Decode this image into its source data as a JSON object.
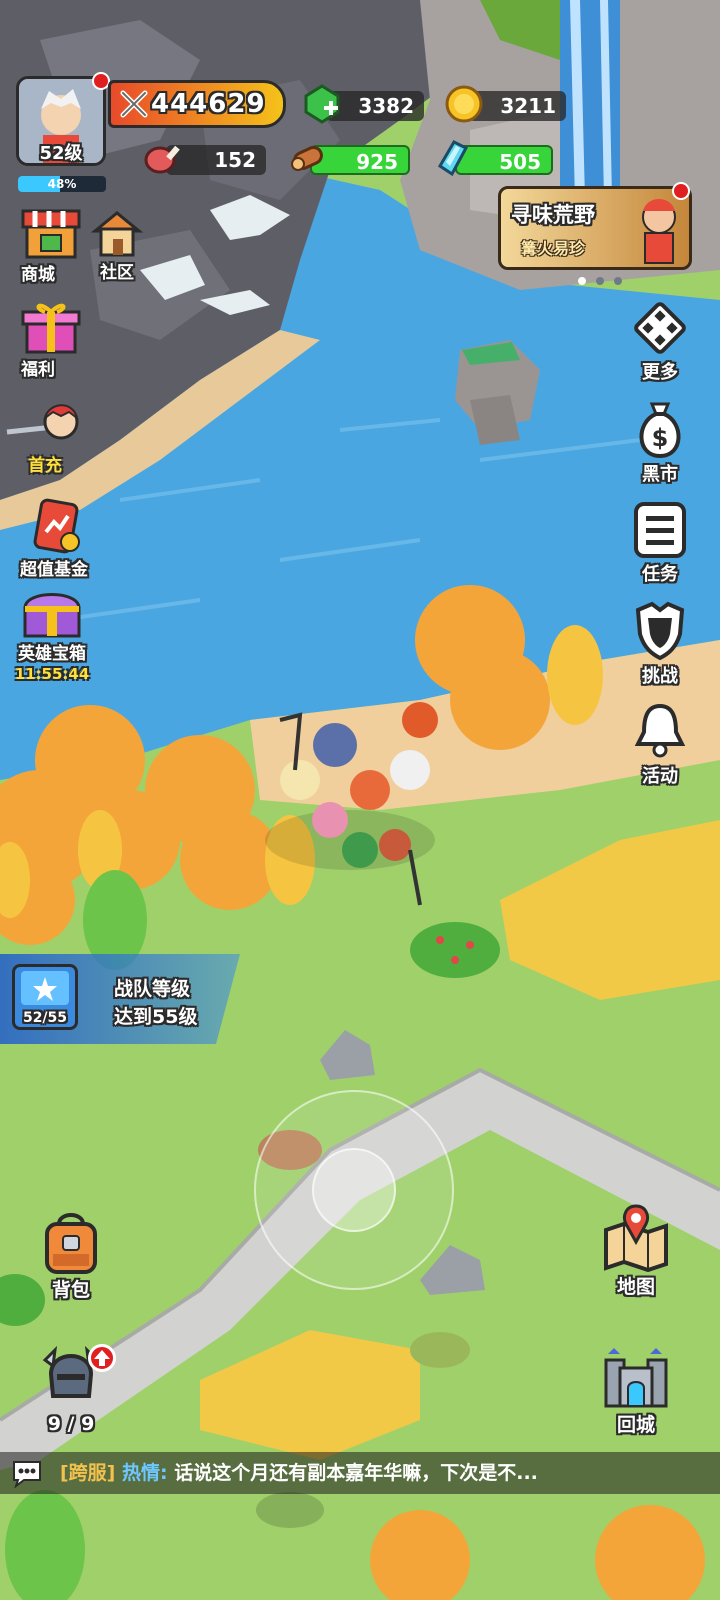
{
  "player": {
    "level_label": "52级",
    "exp_percent_label": "48%",
    "exp_fraction": 0.48,
    "power": "444629"
  },
  "resources": {
    "gems": "3382",
    "gold": "3211",
    "meat": "152",
    "wood": "925",
    "crystal": "505"
  },
  "left_menu": {
    "shop": "商城",
    "community": "社区",
    "welfare": "福利",
    "first_recharge": "首充",
    "fund": "超值基金",
    "hero_chest": "英雄宝箱",
    "hero_chest_timer": "11:55:44"
  },
  "event_banner": {
    "title": "寻味荒野",
    "subtitle": "篝火易珍"
  },
  "right_menu": {
    "more": "更多",
    "black_market": "黑市",
    "tasks": "任务",
    "challenge": "挑战",
    "activity": "活动"
  },
  "team_goal": {
    "progress": "52/55",
    "line1": "战队等级",
    "line2": "达到55级"
  },
  "bottom": {
    "backpack": "背包",
    "heroes_count": "9 / 9",
    "map": "地图",
    "return_city": "回城"
  },
  "chat": {
    "channel": "[跨服]",
    "sender": "热情:",
    "message": "话说这个月还有副本嘉年华嘛，下次是不..."
  },
  "colors": {
    "water": "#4aa6e0",
    "grass": "#9fd06a",
    "power_banner": "#f5c21a",
    "green_bar": "#37d43a",
    "timer_yellow": "#ffe03a",
    "chat_channel": "#f2c14e",
    "chat_sender": "#6ec8ff"
  }
}
